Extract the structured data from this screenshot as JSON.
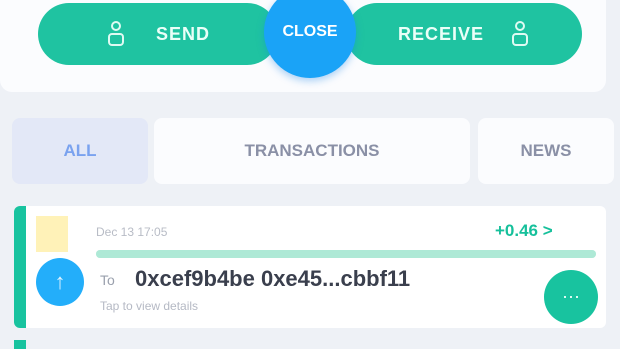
{
  "actions": {
    "send_label": "SEND",
    "center_label": "CLOSE",
    "receive_label": "RECEIVE"
  },
  "tabs": [
    {
      "label": "ALL"
    },
    {
      "label": "TRANSACTIONS"
    },
    {
      "label": "NEWS"
    }
  ],
  "transaction": {
    "date": "Dec 13 17:05",
    "amount": "+0.46 >",
    "progress": 1.0,
    "prefix": "To",
    "name": "0xcef9b4be 0xe45...cbbf11",
    "subtitle": "Tap to view details",
    "avatar_glyph": "↑",
    "action_glyph": "⋯"
  },
  "colors": {
    "primary": "#1fc3a1",
    "accent": "#1aa3f7",
    "tab_active_bg": "#e3e8f7",
    "tab_active_text": "#7aa2ef"
  }
}
